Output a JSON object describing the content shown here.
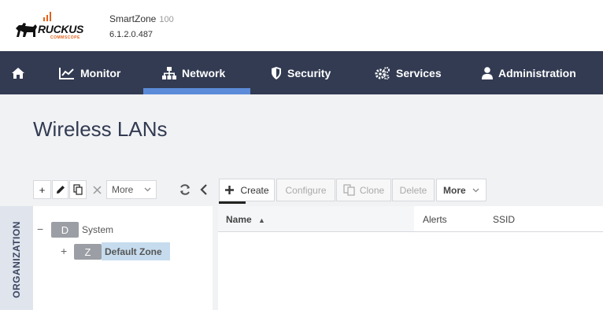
{
  "header": {
    "brand": "RUCKUS",
    "brand_sub": "COMMSCOPE",
    "product_name": "SmartZone",
    "product_model": "100",
    "version": "6.1.2.0.487"
  },
  "nav": {
    "items": [
      {
        "label": "",
        "icon": "home-icon"
      },
      {
        "label": "Monitor",
        "icon": "chart-icon"
      },
      {
        "label": "Network",
        "icon": "network-icon",
        "active": true
      },
      {
        "label": "Security",
        "icon": "shield-icon"
      },
      {
        "label": "Services",
        "icon": "gears-icon"
      },
      {
        "label": "Administration",
        "icon": "user-icon"
      }
    ],
    "bg_color": "#323b52",
    "active_color": "#5b8bd8"
  },
  "page": {
    "title": "Wireless LANs"
  },
  "left_toolbar": {
    "add": "+",
    "more_label": "More"
  },
  "right_toolbar": {
    "create_label": "Create",
    "configure_label": "Configure",
    "clone_label": "Clone",
    "delete_label": "Delete",
    "more_label": "More"
  },
  "sidebar": {
    "org_label": "ORGANIZATION"
  },
  "tree": {
    "root": {
      "toggle": "−",
      "badge": "D",
      "label": "System"
    },
    "child": {
      "toggle": "+",
      "badge": "Z",
      "label": "Default Zone",
      "selected": true
    }
  },
  "table": {
    "columns": [
      "Name",
      "Alerts",
      "SSID"
    ],
    "sort_column": "Name",
    "sort_indicator": "▲"
  }
}
